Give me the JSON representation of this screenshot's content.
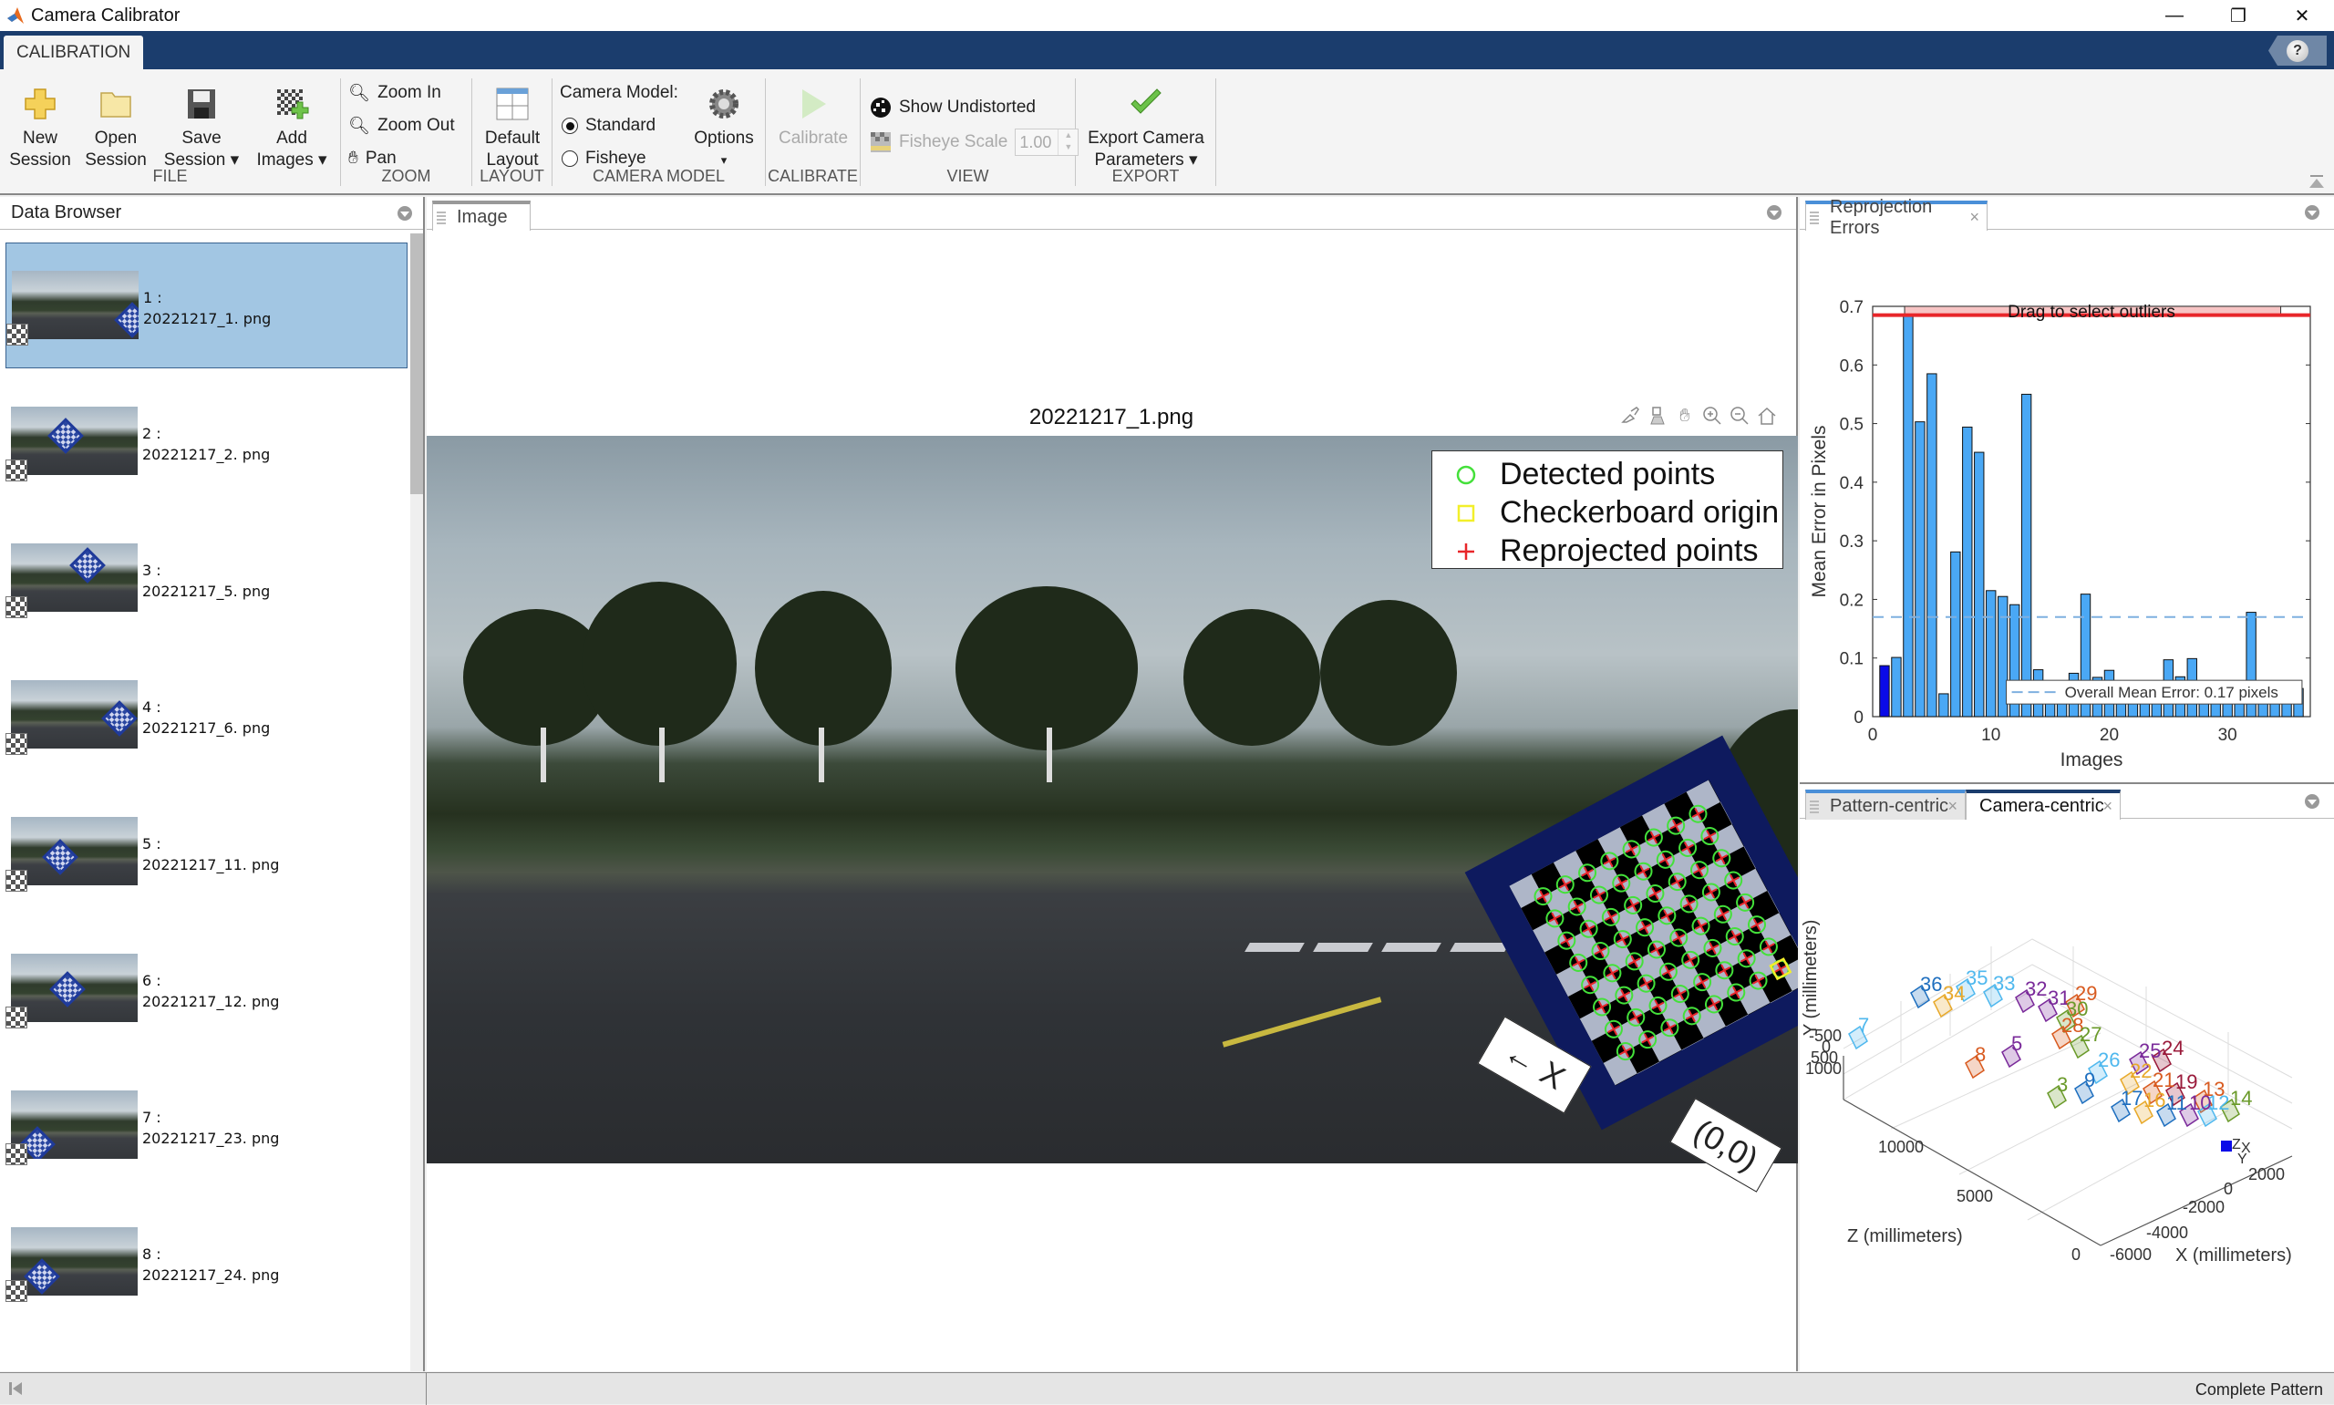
{
  "window": {
    "title": "Camera Calibrator",
    "controls": {
      "minimize": "—",
      "restore": "❐",
      "close": "✕"
    }
  },
  "ribbon": {
    "tab": "CALIBRATION",
    "help_icon": "help-icon",
    "groups": {
      "file": {
        "label": "FILE",
        "new_session": [
          "New",
          "Session"
        ],
        "open_session": [
          "Open",
          "Session"
        ],
        "save_session": [
          "Save",
          "Session ▾"
        ],
        "add_images": [
          "Add",
          "Images ▾"
        ]
      },
      "zoom": {
        "label": "ZOOM",
        "zoom_in": "Zoom In",
        "zoom_out": "Zoom Out",
        "pan": "Pan"
      },
      "layout": {
        "label": "LAYOUT",
        "default_layout": [
          "Default",
          "Layout"
        ]
      },
      "camera_model": {
        "label": "CAMERA MODEL",
        "caption": "Camera Model:",
        "options": [
          {
            "label": "Standard",
            "selected": true
          },
          {
            "label": "Fisheye",
            "selected": false
          }
        ],
        "options_button": "Options",
        "options_arrow": "▾"
      },
      "calibrate": {
        "label": "CALIBRATE",
        "calibrate_button": "Calibrate",
        "enabled": false
      },
      "view": {
        "label": "VIEW",
        "show_undistorted": "Show Undistorted",
        "fisheye_scale_label": "Fisheye Scale",
        "fisheye_scale_value": "1.00",
        "fisheye_scale_enabled": false
      },
      "export": {
        "label": "EXPORT",
        "export_button": [
          "Export Camera",
          "Parameters ▾"
        ]
      }
    }
  },
  "data_browser": {
    "title": "Data Browser",
    "items": [
      {
        "index": "1 :",
        "filename": "20221217_1. png",
        "selected": true
      },
      {
        "index": "2 :",
        "filename": "20221217_2. png",
        "selected": false
      },
      {
        "index": "3 :",
        "filename": "20221217_5. png",
        "selected": false
      },
      {
        "index": "4 :",
        "filename": "20221217_6. png",
        "selected": false
      },
      {
        "index": "5 :",
        "filename": "20221217_11. png",
        "selected": false
      },
      {
        "index": "6 :",
        "filename": "20221217_12. png",
        "selected": false
      },
      {
        "index": "7 :",
        "filename": "20221217_23. png",
        "selected": false
      },
      {
        "index": "8 :",
        "filename": "20221217_24. png",
        "selected": false
      }
    ]
  },
  "image_panel": {
    "tab": "Image",
    "figure_title": "20221217_1.png",
    "legend": [
      {
        "label": "Detected points",
        "marker": "circle",
        "color": "#44e03a"
      },
      {
        "label": "Checkerboard origin",
        "marker": "square",
        "color": "#f2ef2a"
      },
      {
        "label": "Reprojected points",
        "marker": "plus",
        "color": "#e8262a"
      }
    ],
    "axis_label_x": "← X",
    "origin_label": "(0,0)",
    "axes_toolbar": [
      "brush-icon",
      "data-tip-icon",
      "pan-hand-icon",
      "zoom-in-icon",
      "zoom-out-icon",
      "home-icon"
    ]
  },
  "reprojection_panel": {
    "tab": "Reprojection Errors",
    "close": "×"
  },
  "views_panel": {
    "tabs": [
      {
        "label": "Pattern-centric",
        "active": false,
        "close": "×"
      },
      {
        "label": "Camera-centric",
        "active": true,
        "close": "×"
      }
    ],
    "plot": {
      "xlabel": "X (millimeters)",
      "ylabel": "Y (millimeters)",
      "zlabel": "Z (millimeters)",
      "x_ticks": [
        "-6000",
        "-4000",
        "-2000",
        "0",
        "2000"
      ],
      "y_ticks": [
        "-500",
        "0",
        "500",
        "1000"
      ],
      "z_ticks": [
        "0",
        "5000",
        "10000"
      ],
      "camera_axis_labels": [
        "Z",
        "X",
        "Y"
      ],
      "camera_axis_subscript": "c",
      "pattern_labels": [
        "7",
        "36",
        "34",
        "35",
        "33",
        "32",
        "31",
        "29",
        "30",
        "28",
        "27",
        "8",
        "5",
        "26",
        "9",
        "3",
        "25",
        "24",
        "22",
        "21",
        "19",
        "13",
        "17",
        "16",
        "11",
        "10",
        "12",
        "14"
      ]
    }
  },
  "status_bar": {
    "text": "Complete Pattern"
  },
  "chart_data": {
    "type": "bar",
    "title": "",
    "xlabel": "Images",
    "ylabel": "Mean Error in Pixels",
    "xlim": [
      0,
      37
    ],
    "ylim": [
      0,
      0.7
    ],
    "x_ticks": [
      0,
      10,
      20,
      30
    ],
    "y_ticks": [
      0,
      0.1,
      0.2,
      0.3,
      0.4,
      0.5,
      0.6,
      0.7
    ],
    "categories": [
      1,
      2,
      3,
      4,
      5,
      6,
      7,
      8,
      9,
      10,
      11,
      12,
      13,
      14,
      15,
      16,
      17,
      18,
      19,
      20,
      21,
      22,
      23,
      24,
      25,
      26,
      27,
      28,
      29,
      30,
      31,
      32,
      33,
      34,
      35,
      36
    ],
    "values": [
      0.087,
      0.101,
      0.685,
      0.503,
      0.585,
      0.039,
      0.281,
      0.494,
      0.451,
      0.215,
      0.205,
      0.191,
      0.55,
      0.08,
      0.05,
      0.05,
      0.074,
      0.209,
      0.067,
      0.079,
      0.05,
      0.05,
      0.05,
      0.05,
      0.097,
      0.068,
      0.099,
      0.05,
      0.05,
      0.05,
      0.05,
      0.178,
      0.05,
      0.05,
      0.05,
      0.048
    ],
    "selected_index": 1,
    "bar_color": "#4aa8f5",
    "selected_color": "#0a0ae8",
    "mean_line": {
      "value": 0.17,
      "label": "Overall Mean Error: 0.17 pixels",
      "color": "#7fb0e0"
    },
    "outlier_threshold": {
      "value": 0.685,
      "label": "Drag to select outliers",
      "color": "#e8262a"
    },
    "legend_position": "bottom-right"
  }
}
